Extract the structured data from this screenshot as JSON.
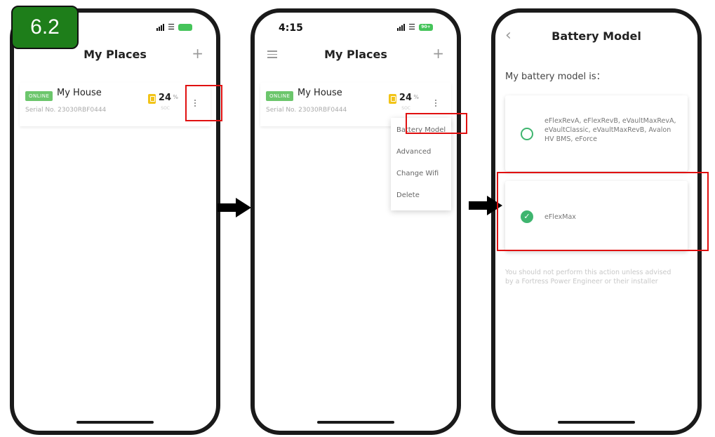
{
  "step": "6.2",
  "screen1": {
    "title": "My Places",
    "place": {
      "status": "ONLINE",
      "name": "My House",
      "serial": "Serial No. 23030RBF0444",
      "soc": "24",
      "soc_unit": "%",
      "soc_label": "SOC"
    }
  },
  "screen2": {
    "time": "4:15",
    "battery_badge": "90+",
    "title": "My Places",
    "place": {
      "status": "ONLINE",
      "name": "My House",
      "serial": "Serial No. 23030RBF0444",
      "soc": "24",
      "soc_unit": "%",
      "soc_label": "SOC"
    },
    "menu": [
      "Battery Model",
      "Advanced",
      "Change Wifi",
      "Delete"
    ]
  },
  "screen3": {
    "title": "Battery Model",
    "question": "My battery model is：",
    "options": [
      {
        "label": "eFlexRevA, eFlexRevB, eVaultMaxRevA, eVaultClassic, eVaultMaxRevB, Avalon HV BMS, eForce",
        "selected": false
      },
      {
        "label": "eFlexMax",
        "selected": true
      }
    ],
    "warning": "You should not perform this action unless advised by a Fortress Power Engineer or their installer"
  },
  "colors": {
    "online": "#6cc66c",
    "accent": "#3fb56f",
    "highlight": "#e01010",
    "badge": "#1e7e1a"
  }
}
